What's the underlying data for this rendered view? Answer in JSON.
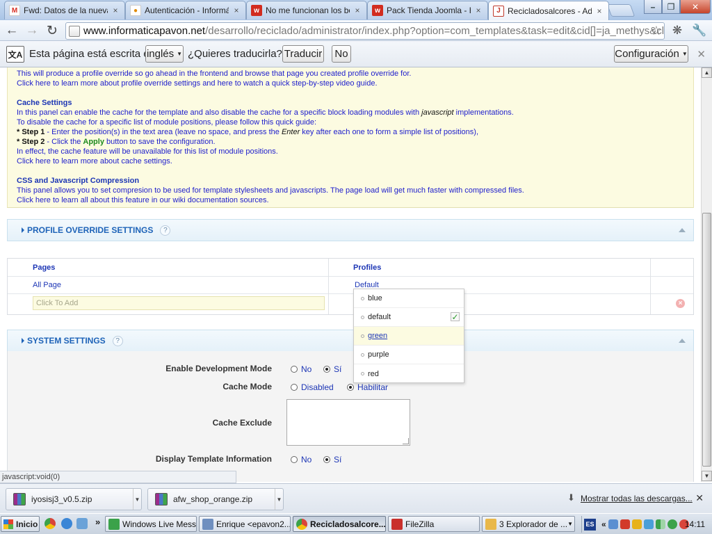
{
  "browser": {
    "tabs": [
      {
        "label": "Fwd: Datos de la nueva ti",
        "favicon": "gmail-icon",
        "color": "#d93025",
        "glyph": "M"
      },
      {
        "label": "Autenticación - Informátic",
        "favicon": "dots-icon",
        "color": "#e08a00",
        "glyph": "•"
      },
      {
        "label": "No me funcionan los botor",
        "favicon": "w-logo-icon",
        "color": "#d22c1f",
        "glyph": "w"
      },
      {
        "label": "Pack Tienda Joomla - Host",
        "favicon": "w-logo-icon",
        "color": "#d22c1f",
        "glyph": "w"
      },
      {
        "label": "Recicladosalcores - Admin",
        "favicon": "joomla-admin-icon",
        "color": "#c0392b",
        "glyph": "J"
      }
    ],
    "tab_close": "×",
    "window_controls": {
      "minimize": "–",
      "maximize": "❐",
      "close": "✕"
    },
    "url": {
      "host": "www.informaticapavon.net",
      "path": "/desarrollo/reciclado/administrator/index.php?option=com_templates&task=edit&cid[]=ja_methys&client="
    }
  },
  "translate_bar": {
    "prefix": "Esta página está escrita en",
    "language": "inglés",
    "question": "¿Quieres traducirla?",
    "translate_button": "Traducir",
    "no_button": "No",
    "options_button": "Configuración",
    "close": "✕"
  },
  "info": {
    "line_profile_1": "This will produce a profile override so go ahead in the frontend and browse that page you created profile override for.",
    "line_profile_2_link1": "Click here",
    "line_profile_2_mid": " to learn more about profile override settings and ",
    "line_profile_2_link2": "here",
    "line_profile_2_end": " to watch a quick step-by-step video guide.",
    "cache_title": "Cache Settings",
    "cache_1a": "In this panel can enable the cache for the template and also disable the cache for a specific block loading modules with ",
    "cache_1b": "javascript",
    "cache_1c": " implementations.",
    "cache_2": "To disable the cache for a specific list of module positions, please follow this quick guide:",
    "step1_label": "* Step 1",
    "step1_a": " - Enter the position(s) in the text area (leave no space, and press the ",
    "step1_b": "Enter",
    "step1_c": " key after each one to form a simple list of positions),",
    "step2_label": "* Step 2",
    "step2_a": " - Click the ",
    "step2_b": "Apply",
    "step2_c": " button to save the configuration.",
    "cache_3": "In effect, the cache feature will be unavailable for this list of module positions.",
    "cache_4_link": "Click here",
    "cache_4_end": " to learn more about cache settings.",
    "css_title": "CSS and Javascript Compression",
    "css_1": "This panel allows you to set compresion to be used for template stylesheets and javascripts. The page load will get much faster with compressed files.",
    "css_2_link": "Click here",
    "css_2_end": " to learn all about this feature in our wiki documentation sources."
  },
  "profile_override": {
    "title": "PROFILE OVERRIDE SETTINGS",
    "help": "?",
    "col_pages": "Pages",
    "col_profiles": "Profiles",
    "row_page": "All Page",
    "row_profile": "Default",
    "add_placeholder": "Click To Add",
    "remove": "×"
  },
  "profile_dropdown": {
    "options": [
      "blue",
      "default",
      "green",
      "purple",
      "red"
    ],
    "selected": "default",
    "hovered": "green",
    "check": "✓"
  },
  "system_settings": {
    "title": "SYSTEM SETTINGS",
    "help": "?",
    "dev_mode_label": "Enable Development Mode",
    "dev_mode_no": "No",
    "dev_mode_yes": "Sí",
    "cache_mode_label": "Cache Mode",
    "cache_disabled": "Disabled",
    "cache_enabled": "Habilitar",
    "cache_exclude_label": "Cache Exclude",
    "display_info_label": "Display Template Information",
    "display_no": "No",
    "display_yes": "Sí"
  },
  "status_bar": {
    "text": "javascript:void(0)"
  },
  "downloads": {
    "items": [
      "iyosisj3_v0.5.zip",
      "afw_shop_orange.zip"
    ],
    "show_all": "Mostrar todas las descargas...",
    "close": "✕"
  },
  "taskbar": {
    "start": "Inicio",
    "more": "»",
    "buttons": [
      {
        "label": "Windows Live Mess...",
        "icon": "messenger-icon",
        "color": "#3ba24a"
      },
      {
        "label": "Enrique <epavon2...",
        "icon": "mail-icon",
        "color": "#6f8fbf"
      },
      {
        "label": "Recicladosalcore...",
        "icon": "chrome-icon",
        "color": "#d9453a"
      },
      {
        "label": "FileZilla",
        "icon": "filezilla-icon",
        "color": "#c9302c"
      },
      {
        "label": "3 Explorador de ...",
        "icon": "folder-icon",
        "color": "#e9b84a"
      }
    ],
    "lang": "ES",
    "tray_more": "«",
    "clock": "14:11"
  },
  "colors": {
    "link": "#1d36b5",
    "info_bg": "#fcfbe1",
    "section_title": "#1e63b8"
  }
}
